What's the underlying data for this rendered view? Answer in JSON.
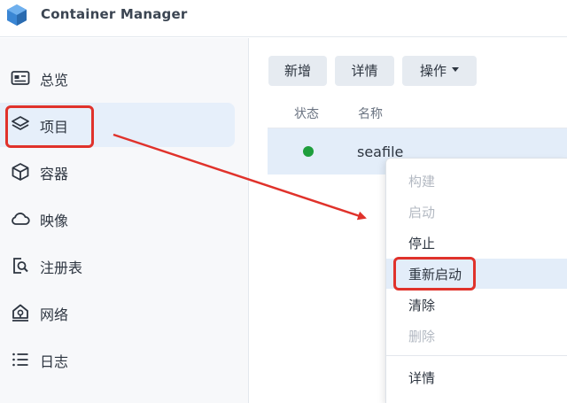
{
  "app": {
    "title": "Container Manager"
  },
  "sidebar": {
    "items": [
      {
        "label": "总览",
        "icon": "overview-icon"
      },
      {
        "label": "项目",
        "icon": "layers-icon"
      },
      {
        "label": "容器",
        "icon": "box-icon"
      },
      {
        "label": "映像",
        "icon": "cloud-icon"
      },
      {
        "label": "注册表",
        "icon": "registry-search-icon"
      },
      {
        "label": "网络",
        "icon": "network-icon"
      },
      {
        "label": "日志",
        "icon": "list-icon"
      }
    ],
    "active_item": "项目"
  },
  "toolbar": {
    "new_label": "新增",
    "details_label": "详情",
    "actions_label": "操作"
  },
  "table": {
    "headers": [
      "状态",
      "名称"
    ],
    "rows": [
      {
        "status": "running",
        "name": "seafile"
      }
    ]
  },
  "context_menu": {
    "items": [
      {
        "label": "构建",
        "enabled": false
      },
      {
        "label": "启动",
        "enabled": false
      },
      {
        "label": "停止",
        "enabled": true
      },
      {
        "label": "重新启动",
        "enabled": true,
        "highlighted": true
      },
      {
        "label": "清除",
        "enabled": true
      },
      {
        "label": "删除",
        "enabled": false
      },
      {
        "label": "详情",
        "enabled": true
      }
    ]
  },
  "colors": {
    "accent": "#e6effa",
    "annotation_red": "#e0322b",
    "status_running": "#1e9e3c"
  }
}
